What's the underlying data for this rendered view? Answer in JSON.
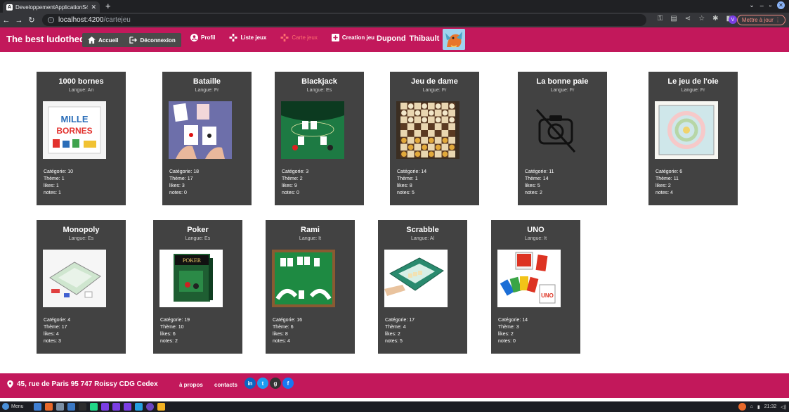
{
  "browser": {
    "tab_title": "DeveloppementApplicationS4",
    "tab_favicon": "A",
    "url_host": "localhost:4200",
    "url_path": "/cartejeu",
    "update_label": "Mettre à jour",
    "profile_initial": "V"
  },
  "header": {
    "brand": "The best ludotheque",
    "nav": {
      "accueil": "Accueil",
      "deconnexion": "Déconnexion",
      "profil": "Profil",
      "liste_jeux": "Liste jeux",
      "carte_jeux": "Carte jeux",
      "creation_jeu": "Creation jeu"
    },
    "user": {
      "last": "Dupond",
      "first": "Thibault"
    }
  },
  "labels": {
    "categorie": "Catégorie: ",
    "theme": "Thème: ",
    "likes": "likes: ",
    "notes": "notes: ",
    "langue": "Langue: "
  },
  "games": [
    {
      "name": "1000 bornes",
      "langue": "An",
      "categorie": "10",
      "theme": "1",
      "likes": "1",
      "notes": "1",
      "image": "mille-bornes-box"
    },
    {
      "name": "Bataille",
      "langue": "Fr",
      "categorie": "18",
      "theme": "17",
      "likes": "3",
      "notes": "0",
      "image": "playing-cards-hands"
    },
    {
      "name": "Blackjack",
      "langue": "Es",
      "categorie": "3",
      "theme": "2",
      "likes": "9",
      "notes": "0",
      "image": "blackjack-table"
    },
    {
      "name": "Jeu de dame",
      "langue": "Fr",
      "categorie": "14",
      "theme": "1",
      "likes": "8",
      "notes": "5",
      "image": "checkers-board"
    },
    {
      "name": "La bonne paie",
      "langue": "Fr",
      "categorie": "11",
      "theme": "14",
      "likes": "5",
      "notes": "2",
      "image": "no-photo-icon"
    },
    {
      "name": "Le jeu de l'oie",
      "langue": "Fr",
      "categorie": "6",
      "theme": "11",
      "likes": "2",
      "notes": "4",
      "image": "goose-game-board"
    },
    {
      "name": "Monopoly",
      "langue": "Es",
      "categorie": "4",
      "theme": "17",
      "likes": "4",
      "notes": "3",
      "image": "monopoly-board"
    },
    {
      "name": "Poker",
      "langue": "Es",
      "categorie": "19",
      "theme": "10",
      "likes": "6",
      "notes": "2",
      "image": "poker-box"
    },
    {
      "name": "Rami",
      "langue": "It",
      "categorie": "16",
      "theme": "6",
      "likes": "8",
      "notes": "4",
      "image": "rami-cards-table"
    },
    {
      "name": "Scrabble",
      "langue": "Al",
      "categorie": "17",
      "theme": "4",
      "likes": "2",
      "notes": "5",
      "image": "scrabble-board"
    },
    {
      "name": "UNO",
      "langue": "It",
      "categorie": "14",
      "theme": "3",
      "likes": "2",
      "notes": "0",
      "image": "uno-cards"
    }
  ],
  "footer": {
    "address": "45, rue de Paris 95 747 Roissy CDG Cedex",
    "about": "à propos",
    "contacts": "contacts",
    "social": [
      {
        "name": "linkedin-icon",
        "glyph": "in",
        "color": "#0a66c2"
      },
      {
        "name": "twitter-icon",
        "glyph": "t",
        "color": "#1d9bf0"
      },
      {
        "name": "github-icon",
        "glyph": "g",
        "color": "#333333"
      },
      {
        "name": "facebook-icon",
        "glyph": "f",
        "color": "#1877f2"
      }
    ]
  },
  "taskbar": {
    "menu": "Menu",
    "time": "21:32"
  },
  "colors": {
    "primary": "#c2185b",
    "card": "#424242",
    "active_link": "#ff6f6f"
  }
}
